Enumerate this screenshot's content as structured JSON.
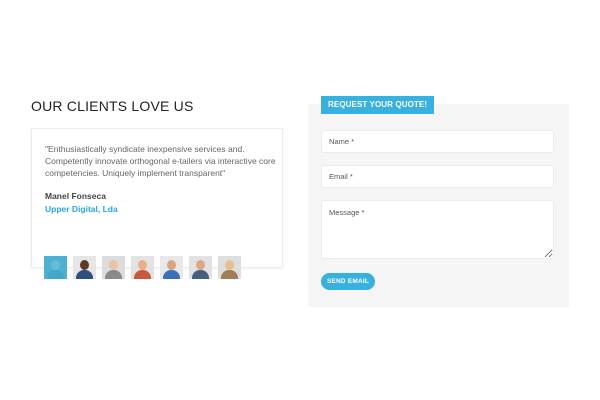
{
  "testimonials": {
    "title": "OUR CLIENTS LOVE US",
    "quote": "\"Enthusiastically syndicate inexpensive services and. Competently innovate orthogonal e-tailers via interactive core competencies. Uniquely implement transparent\"",
    "author_name": "Manel Fonseca",
    "author_company": "Upper Digital, Lda",
    "accent_color": "#2aa6dc",
    "avatars": [
      {
        "icon": "client-avatar",
        "active": true
      },
      {
        "icon": "client-avatar",
        "active": false
      },
      {
        "icon": "client-avatar",
        "active": false
      },
      {
        "icon": "client-avatar",
        "active": false
      },
      {
        "icon": "client-avatar",
        "active": false
      },
      {
        "icon": "client-avatar",
        "active": false
      },
      {
        "icon": "client-avatar",
        "active": false
      }
    ]
  },
  "quote_form": {
    "tag_label": "REQUEST YOUR QUOTE!",
    "name_placeholder": "Name *",
    "email_placeholder": "Email *",
    "message_placeholder": "Message *",
    "send_label": "SEND EMAIL",
    "button_color": "#38b1de",
    "panel_color": "#f5f5f5"
  }
}
